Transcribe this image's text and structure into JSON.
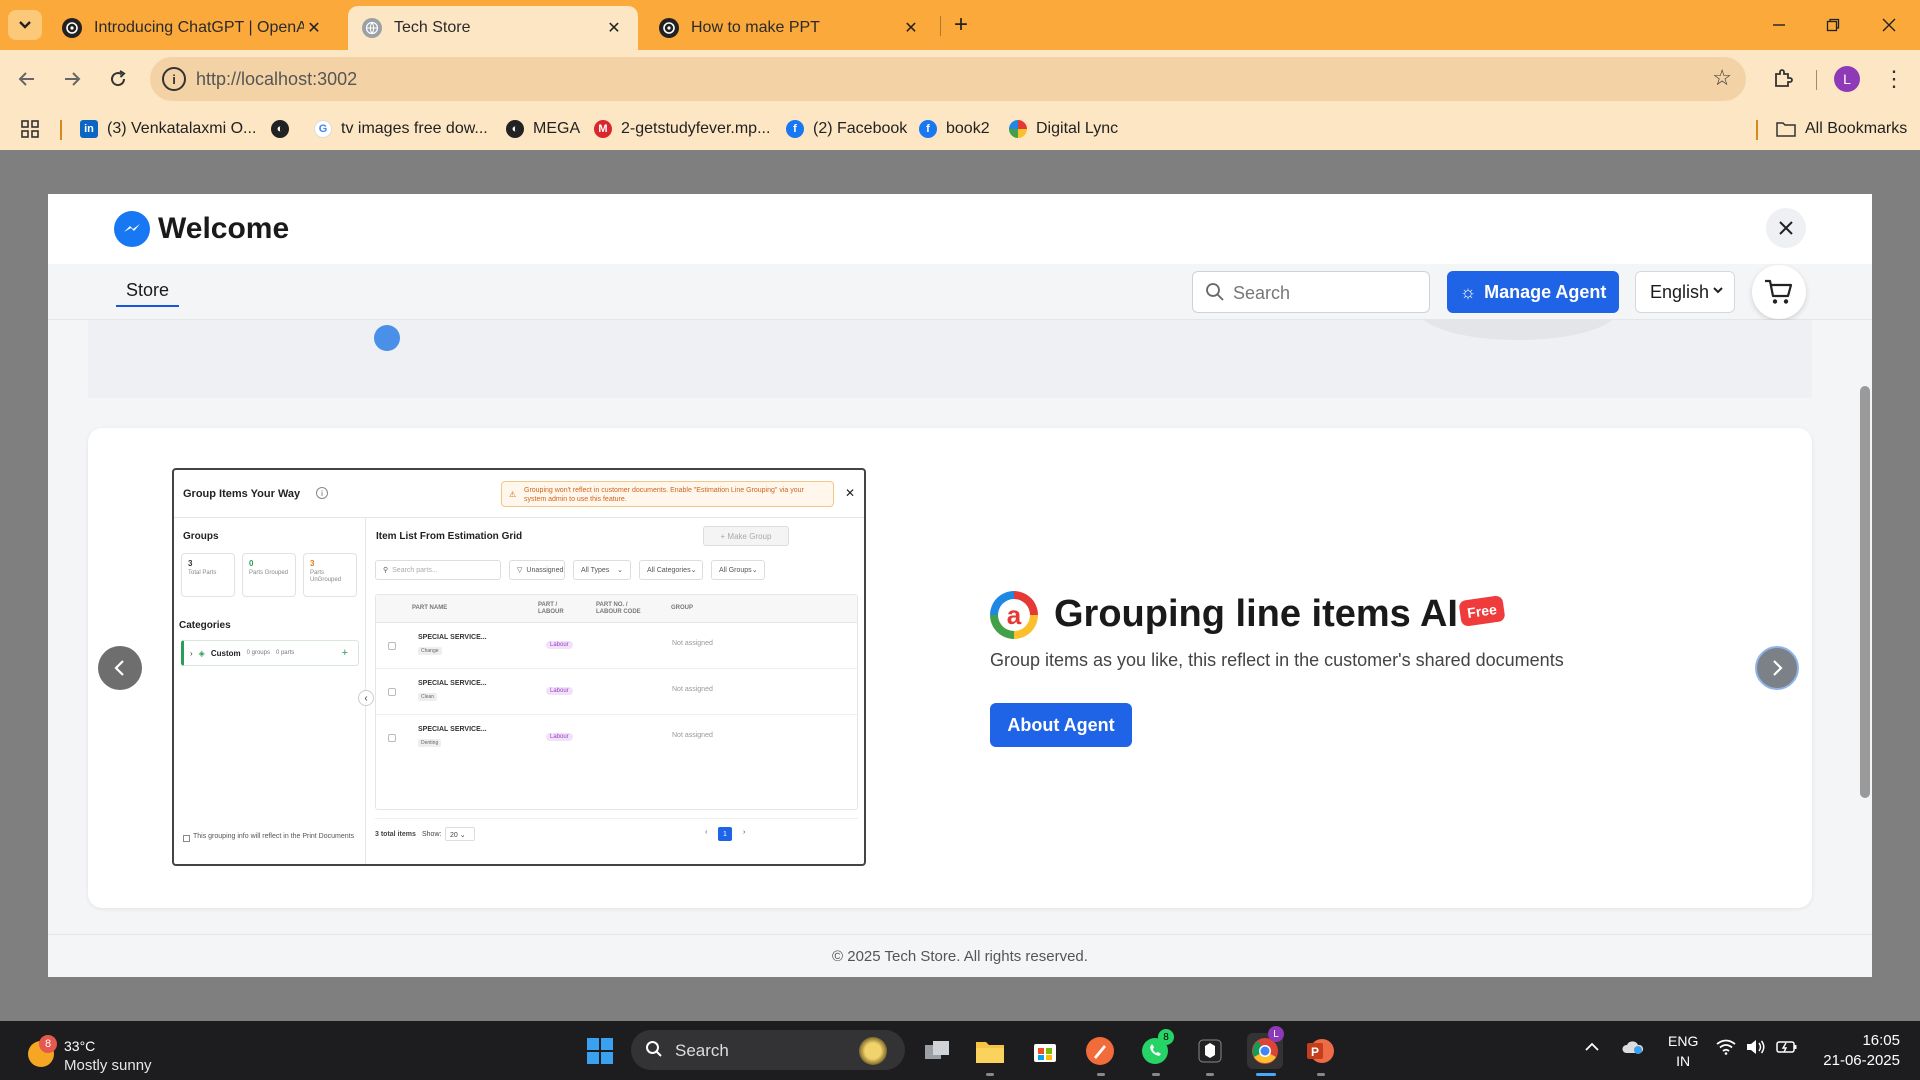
{
  "browser": {
    "tabs": [
      {
        "title": "Introducing ChatGPT | OpenAI",
        "active": false
      },
      {
        "title": "Tech Store",
        "active": true
      },
      {
        "title": "How to make PPT",
        "active": false
      }
    ],
    "url": "http://localhost:3002",
    "bookmarks": [
      {
        "label": "(3) Venkatalaxmi O...",
        "icon": "linkedin-icon"
      },
      {
        "label": "",
        "icon": "globe-icon"
      },
      {
        "label": "tv images free dow...",
        "icon": "google-icon"
      },
      {
        "label": "MEGA",
        "icon": "globe-icon"
      },
      {
        "label": "2-getstudyfever.mp...",
        "icon": "mega-icon"
      },
      {
        "label": "(2) Facebook",
        "icon": "facebook-icon"
      },
      {
        "label": "book2",
        "icon": "facebook-icon"
      },
      {
        "label": "Digital Lync",
        "icon": "lync-icon"
      }
    ],
    "all_bookmarks": "All Bookmarks",
    "profile_initial": "L"
  },
  "page": {
    "welcome_title": "Welcome",
    "nav_store": "Store",
    "search_placeholder": "Search",
    "manage_agent": "Manage Agent",
    "language": "English",
    "agent": {
      "title": "Grouping line items AI",
      "badge": "Free",
      "description": "Group items as you like, this reflect in the customer's shared documents",
      "cta": "About Agent"
    },
    "footer": "© 2025 Tech Store. All rights reserved."
  },
  "preview": {
    "title": "Group Items Your Way",
    "warning": "Grouping won't reflect in customer documents. Enable \"Estimation Line Grouping\" via your system admin to use this feature.",
    "groups_label": "Groups",
    "stats": [
      {
        "value": "3",
        "label": "Total Parts",
        "color": "#333333"
      },
      {
        "value": "0",
        "label": "Parts Grouped",
        "color": "#2a9d57"
      },
      {
        "value": "3",
        "label": "Parts UnGrouped",
        "color": "#e07b1a"
      }
    ],
    "categories_label": "Categories",
    "category": {
      "name": "Custom",
      "groups": "0 groups",
      "parts": "0 parts"
    },
    "footnote": "This grouping info will reflect in the Print Documents",
    "list_title": "Item List From Estimation Grid",
    "make_group": "+ Make Group",
    "search_placeholder": "Search parts...",
    "filters": [
      "Unassigned",
      "All Types",
      "All Categories",
      "All Groups"
    ],
    "columns": [
      "PART NAME",
      "PART / LABOUR",
      "PART NO. / LABOUR CODE",
      "GROUP"
    ],
    "rows": [
      {
        "name": "SPECIAL SERVICE...",
        "tag": "Change",
        "type": "Labour",
        "group": "Not assigned"
      },
      {
        "name": "SPECIAL SERVICE...",
        "tag": "Clean",
        "type": "Labour",
        "group": "Not assigned"
      },
      {
        "name": "SPECIAL SERVICE...",
        "tag": "Denting",
        "type": "Labour",
        "group": "Not assigned"
      }
    ],
    "total_items": "3 total items",
    "show_label": "Show:",
    "page_size": "20",
    "current_page": "1"
  },
  "taskbar": {
    "weather_temp": "33°C",
    "weather_condition": "Mostly sunny",
    "weather_badge": "8",
    "search": "Search",
    "whatsapp_badge": "8",
    "lang_line1": "ENG",
    "lang_line2": "IN",
    "time": "16:05",
    "date": "21-06-2025"
  },
  "colors": {
    "tabstrip": "#fba93a",
    "toolbar": "#fde6c4",
    "accent": "#1f63e6",
    "free_badge": "#ef3b3b"
  }
}
